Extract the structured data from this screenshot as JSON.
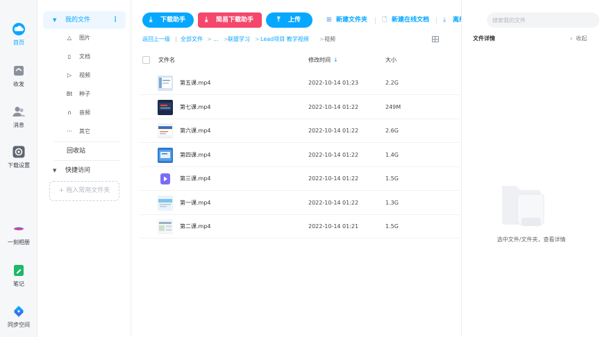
{
  "rail": {
    "items": [
      {
        "label": "首页",
        "icon": "cloud-icon",
        "active": true
      },
      {
        "label": "收发",
        "icon": "inbox-icon"
      },
      {
        "label": "消息",
        "icon": "contacts-icon"
      },
      {
        "label": "下载设置",
        "icon": "gear-icon"
      },
      {
        "label": "一刻相册",
        "icon": "album-icon"
      },
      {
        "label": "笔记",
        "icon": "note-icon"
      },
      {
        "label": "同步空间",
        "icon": "sync-icon"
      }
    ]
  },
  "nav": {
    "my_files": "我的文件",
    "sub_items": [
      {
        "label": "图片",
        "icon": "△"
      },
      {
        "label": "文档",
        "icon": "▯"
      },
      {
        "label": "视频",
        "icon": "▷"
      },
      {
        "label": "种子",
        "icon": "Bt"
      },
      {
        "label": "音频",
        "icon": "∩"
      },
      {
        "label": "其它",
        "icon": "···"
      }
    ],
    "recycle": "回收站",
    "quick_access": "快捷访问",
    "drag_hint": "+ 拖入常用文件夹"
  },
  "toolbar": {
    "download_helper": "下载助手",
    "easy_download": "简易下载助手",
    "upload": "上传",
    "new_folder": "新建文件夹",
    "new_online_doc": "新建在线文档",
    "offline_download": "离线下载"
  },
  "breadcrumb": {
    "back": "返回上一级",
    "all_files": "全部文件",
    "ellipsis": "...",
    "level1": "联盟学习",
    "level2": "Lead项目 教学视频",
    "current": "视频"
  },
  "table": {
    "col_name": "文件名",
    "col_modified": "修改时间",
    "col_size": "大小",
    "rows": [
      {
        "name": "第五课.mp4",
        "modified": "2022-10-14 01:23",
        "size": "2.2G",
        "thumb": "thumb-a"
      },
      {
        "name": "第七课.mp4",
        "modified": "2022-10-14 01:22",
        "size": "249M",
        "thumb": "thumb-b"
      },
      {
        "name": "第六课.mp4",
        "modified": "2022-10-14 01:22",
        "size": "2.6G",
        "thumb": "thumb-c"
      },
      {
        "name": "第四课.mp4",
        "modified": "2022-10-14 01:22",
        "size": "1.4G",
        "thumb": "thumb-d"
      },
      {
        "name": "第三课.mp4",
        "modified": "2022-10-14 01:22",
        "size": "1.5G",
        "thumb": "thumb-video"
      },
      {
        "name": "第一课.mp4",
        "modified": "2022-10-14 01:22",
        "size": "1.3G",
        "thumb": "thumb-e"
      },
      {
        "name": "第二课.mp4",
        "modified": "2022-10-14 01:21",
        "size": "1.5G",
        "thumb": "thumb-f"
      }
    ]
  },
  "detail": {
    "search_placeholder": "搜索我的文件",
    "title": "文件详情",
    "collapse": "收起",
    "empty_text": "选中文件/文件夹，查看详情"
  },
  "colors": {
    "accent": "#06a7ff",
    "easy_download_red": "#f5466b",
    "rail_bg": "#f6f7f9"
  }
}
